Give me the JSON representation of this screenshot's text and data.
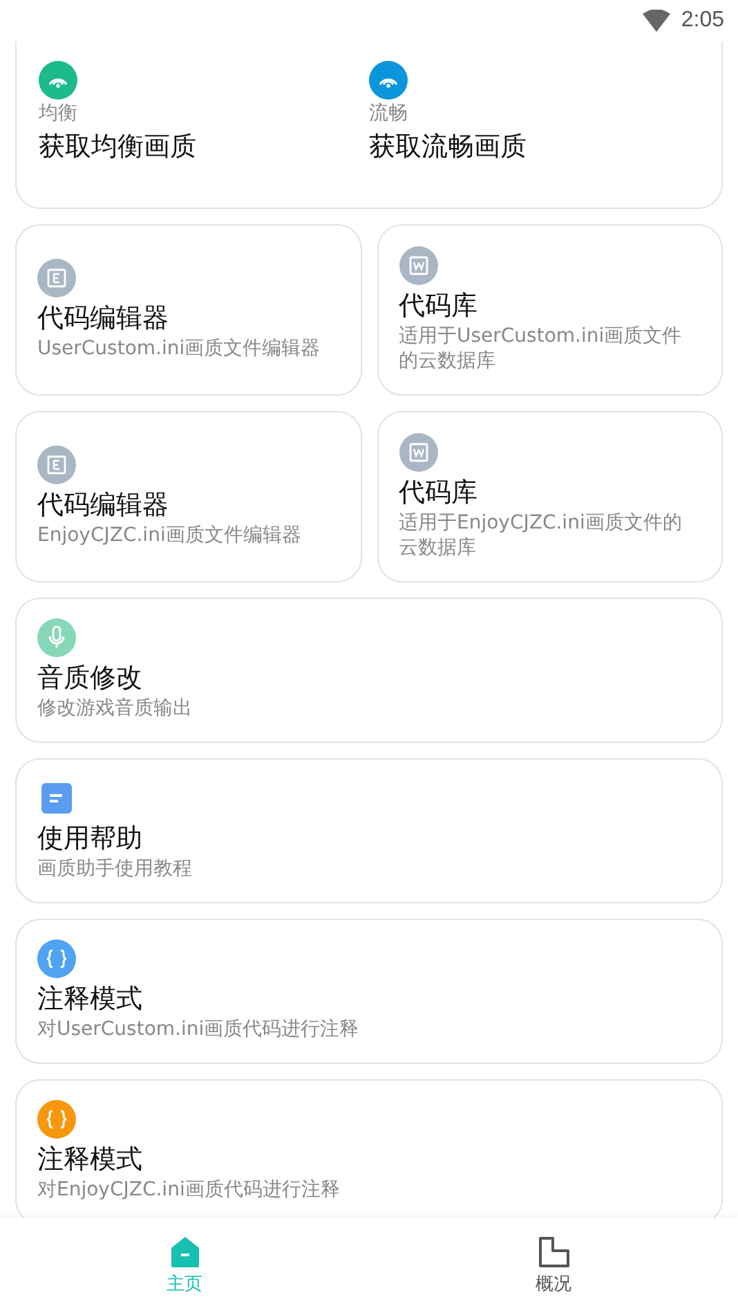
{
  "status_bar": {
    "time": "2:05"
  },
  "top_card": {
    "items": [
      {
        "label": "均衡",
        "title": "获取均衡画质",
        "kind": "gauge",
        "color": "#1dbb8b"
      },
      {
        "label": "流畅",
        "title": "获取流畅画质",
        "kind": "gauge",
        "color": "#0b95dc"
      }
    ]
  },
  "card_rows": [
    {
      "cards": [
        {
          "kind": "editor",
          "color": "#a9b6c4",
          "title": "代码编辑器",
          "subtitle": "UserCustom.ini画质文件编辑器"
        },
        {
          "kind": "library",
          "color": "#a9b6c4",
          "title": "代码库",
          "subtitle": "适用于UserCustom.ini画质文件的云数据库"
        }
      ]
    },
    {
      "cards": [
        {
          "kind": "editor",
          "color": "#a9b6c4",
          "title": "代码编辑器",
          "subtitle": "EnjoyCJZC.ini画质文件编辑器"
        },
        {
          "kind": "library",
          "color": "#a9b6c4",
          "title": "代码库",
          "subtitle": "适用于EnjoyCJZC.ini画质文件的云数据库"
        }
      ]
    },
    {
      "cards": [
        {
          "kind": "mic",
          "color": "#86d8b8",
          "title": "音质修改",
          "subtitle": "修改游戏音质输出"
        }
      ]
    },
    {
      "cards": [
        {
          "kind": "note",
          "color": "#5a9cf0",
          "title": "使用帮助",
          "subtitle": "画质助手使用教程"
        }
      ]
    },
    {
      "cards": [
        {
          "kind": "braces",
          "color": "#4fa3f0",
          "title": "注释模式",
          "subtitle": "对UserCustom.ini画质代码进行注释"
        }
      ]
    },
    {
      "cards": [
        {
          "kind": "braces",
          "color": "#f7970e",
          "title": "注释模式",
          "subtitle": "对EnjoyCJZC.ini画质代码进行注释"
        }
      ]
    }
  ],
  "nav": [
    {
      "label": "主页",
      "kind": "home",
      "selected": true
    },
    {
      "label": "概况",
      "kind": "page",
      "selected": false
    }
  ]
}
